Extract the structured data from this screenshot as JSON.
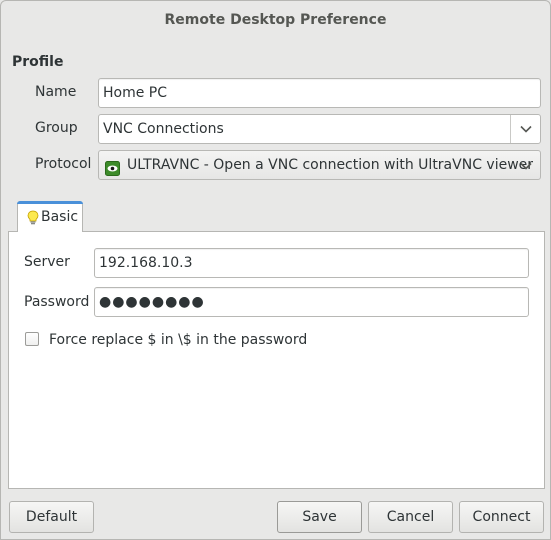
{
  "window": {
    "title": "Remote Desktop Preference"
  },
  "profile": {
    "section_label": "Profile",
    "name_label": "Name",
    "name_value": "Home PC",
    "group_label": "Group",
    "group_value": "VNC Connections",
    "protocol_label": "Protocol",
    "protocol_value": "ULTRAVNC - Open a VNC connection with UltraVNC viewer",
    "protocol_icon": "ultravnc-eye-icon"
  },
  "tabs": [
    {
      "label": "Basic",
      "icon": "lightbulb-icon",
      "active": true
    }
  ],
  "basic": {
    "server_label": "Server",
    "server_value": "192.168.10.3",
    "password_label": "Password",
    "password_value": "●●●●●●●●",
    "force_replace_label": "Force replace $ in \\$ in the password",
    "force_replace_checked": false
  },
  "buttons": {
    "default": "Default",
    "save": "Save",
    "cancel": "Cancel",
    "connect": "Connect"
  },
  "colors": {
    "accent": "#4a90d9",
    "window_bg": "#e8e8e7",
    "icon_green": "#3d8b2a"
  }
}
